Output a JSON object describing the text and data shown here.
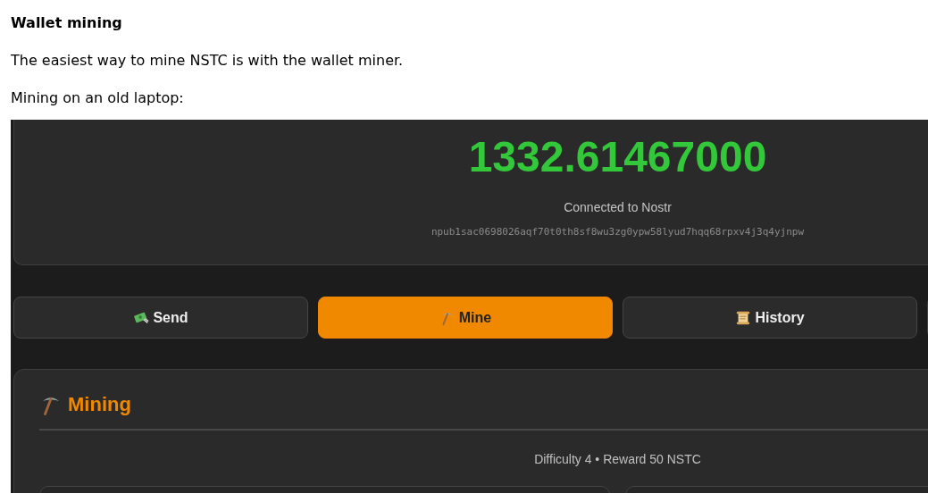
{
  "heading": "Wallet mining",
  "paragraphs": [
    "The easiest way to mine NSTC is with the wallet miner.",
    "Mining on an old laptop:"
  ],
  "screenshot": {
    "balance": "1332.61467000",
    "connection": "Connected to Nostr",
    "pubkey": "npub1sac0698026aqf70t0th8sf8wu3zg0ypw58lyud7hqq68rpxv4j3q4yjnpw",
    "tabs": [
      {
        "kind": "send",
        "label": "Send",
        "selected": false
      },
      {
        "kind": "mine",
        "label": "Mine",
        "selected": true
      },
      {
        "kind": "history",
        "label": "History",
        "selected": false
      },
      {
        "kind": "other",
        "selected": false
      }
    ],
    "mining": {
      "title": "Mining",
      "info": "Difficulty 4 • Reward 50 NSTC",
      "cards": [
        {
          "kind": "panel"
        },
        {
          "kind": "panel"
        }
      ]
    }
  }
}
